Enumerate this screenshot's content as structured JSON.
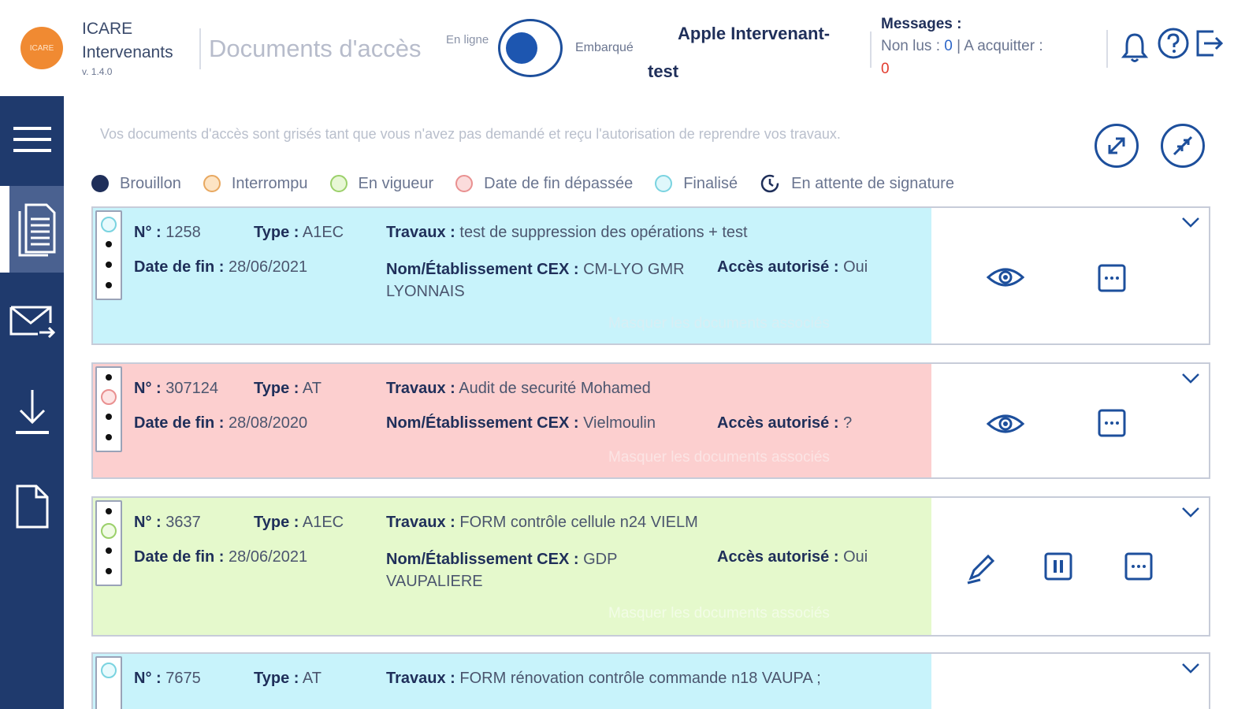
{
  "header": {
    "logo_text": "ICARE",
    "app_name_line1": "ICARE",
    "app_name_line2": "Intervenants",
    "version": "v. 1.4.0",
    "page_title": "Documents d'accès",
    "online_label": "En ligne",
    "embarque_label": "Embarqué",
    "user_line1": "Apple Intervenant-",
    "user_line2": "test",
    "messages_title": "Messages :",
    "unread_label": "Non lus :",
    "unread_count": "0",
    "separator": "|",
    "ack_label": "A acquitter :",
    "ack_count": "0"
  },
  "sidebar": {
    "items": [
      "menu",
      "documents",
      "messages",
      "download",
      "file"
    ]
  },
  "main": {
    "info": "Vos documents d'accès sont grisés tant que vous n'avez pas demandé et reçu l'autorisation de reprendre vos travaux.",
    "legend": [
      {
        "label": "Brouillon",
        "color": "#1f2f5a",
        "fill": "#1f2f5a"
      },
      {
        "label": "Interrompu",
        "color": "#e8a860",
        "fill": "#fde4c4"
      },
      {
        "label": "En vigueur",
        "color": "#9bd06a",
        "fill": "#e8f7d6"
      },
      {
        "label": "Date de fin dépassée",
        "color": "#e99090",
        "fill": "#fbdcdc"
      },
      {
        "label": "Finalisé",
        "color": "#7ad3e0",
        "fill": "#dff7fb"
      },
      {
        "label": "En attente de signature",
        "color": "#1f2f5a",
        "fill": "#ffffff"
      }
    ],
    "cards": [
      {
        "num_label": "N° :",
        "num": "1258",
        "type_label": "Type :",
        "type": "A1EC",
        "travaux_label": "Travaux :",
        "travaux": "test de suppression des opérations + test",
        "date_label": "Date de fin :",
        "date": "28/06/2021",
        "cex_label": "Nom/Établissement CEX :",
        "cex": "CM-LYO GMR LYONNAIS",
        "acces_label": "Accès autorisé :",
        "acces": "Oui",
        "assoc": "Masquer les documents associés",
        "color": "#c8f3fb"
      },
      {
        "num_label": "N° :",
        "num": "307124",
        "type_label": "Type :",
        "type": "AT",
        "travaux_label": "Travaux :",
        "travaux": "Audit de securité Mohamed",
        "date_label": "Date de fin :",
        "date": "28/08/2020",
        "cex_label": "Nom/Établissement CEX :",
        "cex": "Vielmoulin",
        "acces_label": "Accès autorisé :",
        "acces": "?",
        "assoc": "Masquer les documents associés",
        "color": "#fccfcf"
      },
      {
        "num_label": "N° :",
        "num": "3637",
        "type_label": "Type :",
        "type": "A1EC",
        "travaux_label": "Travaux :",
        "travaux": "FORM contrôle cellule n24 VIELM",
        "date_label": "Date de fin :",
        "date": "28/06/2021",
        "cex_label": "Nom/Établissement CEX :",
        "cex": "GDP VAUPALIERE",
        "acces_label": "Accès autorisé :",
        "acces": "Oui",
        "assoc": "Masquer les documents associés",
        "color": "#e5f9cc"
      },
      {
        "num_label": "N° :",
        "num": "7675",
        "type_label": "Type :",
        "type": "AT",
        "travaux_label": "Travaux :",
        "travaux": "FORM rénovation contrôle commande n18 VAUPA ;",
        "color": "#c8f3fb"
      }
    ]
  }
}
